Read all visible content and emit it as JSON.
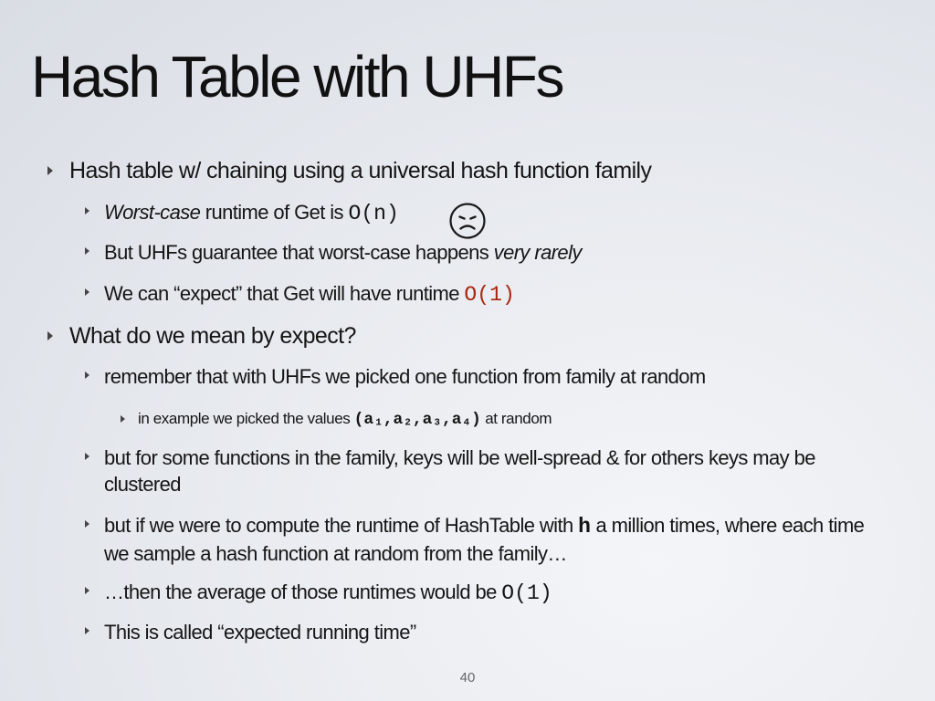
{
  "slide": {
    "title": "Hash Table with UHFs",
    "page_number": "40"
  },
  "bullets": {
    "b1": "Hash table w/ chaining using a universal hash function family",
    "b1_1_italic": "Worst-case",
    "b1_1_text": " runtime of Get is ",
    "b1_1_code": "O(n)",
    "b1_2_text": "But UHFs guarantee that worst-case happens ",
    "b1_2_italic": "very rarely",
    "b1_3_text": "We can “expect” that Get will have runtime ",
    "b1_3_code": "O(1)",
    "b2": "What do we mean  by expect?",
    "b2_1": "remember that with UHFs we picked one function from family at random",
    "b2_1_1_text": "in example we picked the values ",
    "b2_1_1_code": "(a₁,a₂,a₃,a₄)",
    "b2_1_1_tail": " at random",
    "b2_2": "but for some functions in the family, keys will be well-spread & for others keys may be clustered",
    "b2_3_text": "but if we were to compute the runtime of HashTable with ",
    "b2_3_code": "h",
    "b2_3_tail": " a million times, where each time we sample a hash function at random from the family…",
    "b2_4_text": "…then the average of those runtimes would be ",
    "b2_4_code": "O(1)",
    "b2_5": "This is called “expected running time”"
  },
  "icons": {
    "sad_face": "sad-face-icon"
  },
  "colors": {
    "highlight_code": "#a9260f",
    "text": "#151515"
  }
}
